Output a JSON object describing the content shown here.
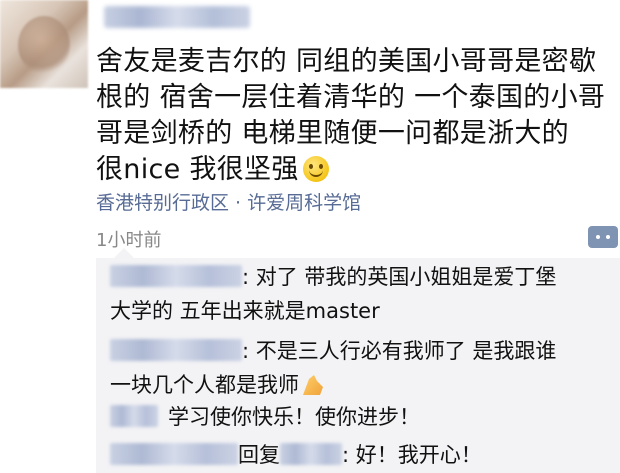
{
  "post": {
    "text_line1": "舍友是麦吉尔的 同组的美国小哥哥是密歇",
    "text_line2": "根的 宿舍一层住着清华的 一个泰国的小哥",
    "text_line3": "哥是剑桥的 电梯里随便一问都是浙大的",
    "text_line4": "很nice 我很坚强",
    "emoji": "smile-emoji",
    "location": "香港特别行政区 · 许爱周科学馆",
    "time": "1小时前"
  },
  "comments": [
    {
      "sep": ":",
      "text_a": " 对了 带我的英国小姐姐是爱丁堡",
      "text_b": "大学的 五年出来就是master"
    },
    {
      "sep": ":",
      "text_a": " 不是三人行必有我师了 是我跟谁",
      "text_b": "一块几个人都是我师",
      "icon": "clap-hands-icon"
    },
    {
      "text": "学习使你快乐！使你进步！"
    },
    {
      "reply_label": "回复",
      "sep": ":",
      "text": " 好！我开心！"
    }
  ],
  "colors": {
    "link": "#576b95",
    "time": "#888888",
    "comment_bg": "#f3f3f5",
    "more_button": "#7f93b2"
  }
}
